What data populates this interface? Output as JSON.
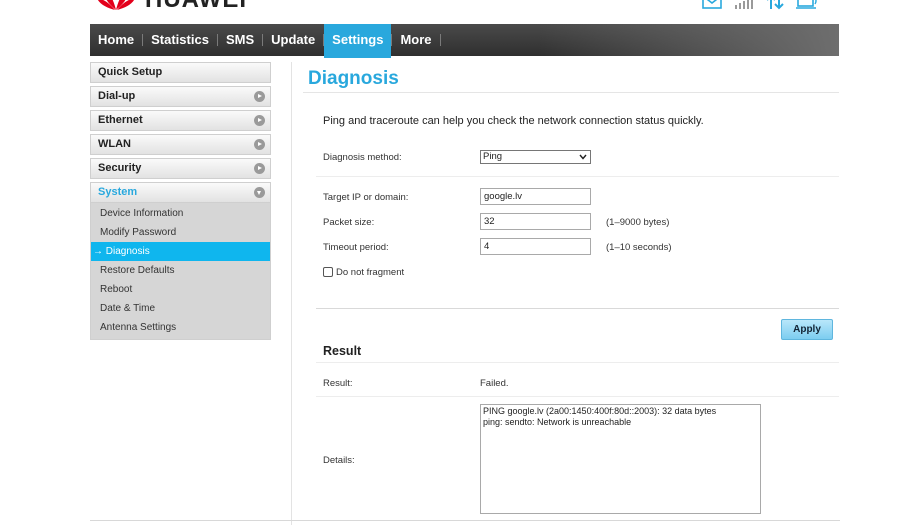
{
  "brand": {
    "name": "HUAWEI"
  },
  "nav": {
    "items": [
      {
        "label": "Home"
      },
      {
        "label": "Statistics"
      },
      {
        "label": "SMS"
      },
      {
        "label": "Update"
      },
      {
        "label": "Settings"
      },
      {
        "label": "More"
      }
    ],
    "active": "Settings"
  },
  "sidebar": {
    "items": [
      {
        "label": "Quick Setup"
      },
      {
        "label": "Dial-up"
      },
      {
        "label": "Ethernet"
      },
      {
        "label": "WLAN"
      },
      {
        "label": "Security"
      },
      {
        "label": "System"
      }
    ],
    "system_sub": [
      {
        "label": "Device Information"
      },
      {
        "label": "Modify Password"
      },
      {
        "label": "Diagnosis"
      },
      {
        "label": "Restore Defaults"
      },
      {
        "label": "Reboot"
      },
      {
        "label": "Date & Time"
      },
      {
        "label": "Antenna Settings"
      }
    ]
  },
  "page": {
    "title": "Diagnosis",
    "intro": "Ping and traceroute can help you check the network connection status quickly."
  },
  "form": {
    "method_label": "Diagnosis method:",
    "method_value": "Ping",
    "target_label": "Target IP or domain:",
    "target_value": "google.lv",
    "packet_label": "Packet size:",
    "packet_value": "32",
    "packet_hint": "(1–9000 bytes)",
    "timeout_label": "Timeout period:",
    "timeout_value": "4",
    "timeout_hint": "(1–10 seconds)",
    "fragment_label": "Do not fragment",
    "apply_label": "Apply"
  },
  "result": {
    "section_title": "Result",
    "result_label": "Result:",
    "result_value": "Failed.",
    "details_label": "Details:",
    "details_value": "PING google.lv (2a00:1450:400f:80d::2003): 32 data bytes\nping: sendto: Network is unreachable"
  },
  "colors": {
    "accent": "#29a8dd",
    "nav_bg": "#333333",
    "active_sub": "#0fb6ee"
  },
  "icons": {
    "top": [
      "envelope-icon",
      "signal-bars-icon",
      "up-down-arrows-icon",
      "computer-link-icon"
    ]
  }
}
